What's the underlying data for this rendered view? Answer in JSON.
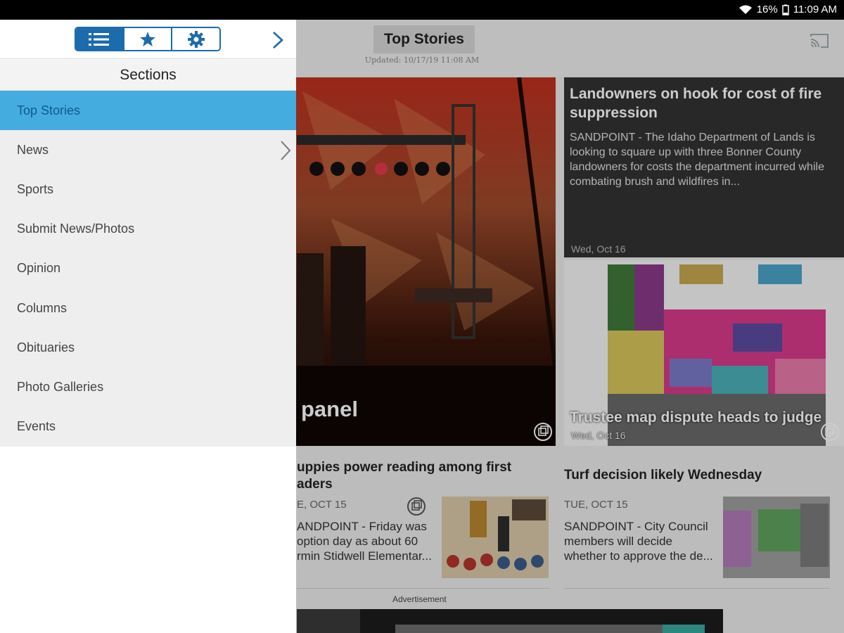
{
  "status_bar": {
    "battery": "16%",
    "time": "11:09 AM",
    "icons": [
      "wifi-icon",
      "battery-icon"
    ]
  },
  "drawer": {
    "tabs": [
      {
        "icon": "list-icon",
        "active": true
      },
      {
        "icon": "star-icon",
        "active": false
      },
      {
        "icon": "gear-icon",
        "active": false
      }
    ],
    "next_icon": "chevron-right-icon",
    "sections_title": "Sections",
    "items": [
      {
        "label": "Top Stories",
        "active": true
      },
      {
        "label": "News",
        "has_submenu": true
      },
      {
        "label": "Sports"
      },
      {
        "label": "Submit News/Photos"
      },
      {
        "label": "Opinion"
      },
      {
        "label": "Columns"
      },
      {
        "label": "Obituaries"
      },
      {
        "label": "Photo Galleries"
      },
      {
        "label": "Events"
      }
    ],
    "accent_color": "#1b6bad",
    "active_bg": "#45ace0"
  },
  "header": {
    "title": "Top Stories",
    "updated": "Updated: 10/17/19 11:08 AM",
    "cast_icon": "cast-icon"
  },
  "hero": {
    "caption": "panel"
  },
  "stories": {
    "dark": {
      "title": "Landowners on hook for cost of fire suppression",
      "summary": "SANDPOINT - The Idaho Department of Lands is looking to square up with three Bonner County landowners for costs the department incurred while combating brush and wildfires in...",
      "date": "Wed, Oct 16"
    },
    "map": {
      "title": "Trustee map dispute heads to judge",
      "date": "Wed, Oct 16"
    },
    "card_a": {
      "title": "uppies power reading among first aders",
      "date": "E, OCT 15",
      "summary": "ANDPOINT - Friday was option day as about 60 rmin Stidwell Elementar..."
    },
    "card_b": {
      "title": "Turf decision likely Wednesday",
      "date": "TUE, OCT 15",
      "summary": "SANDPOINT - City Council members will decide whether to approve the de..."
    }
  },
  "advertisement": {
    "label": "Advertisement"
  }
}
